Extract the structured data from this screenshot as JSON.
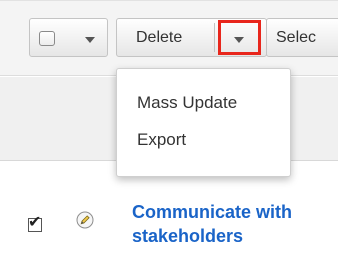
{
  "toolbar": {
    "select_all": {
      "icon": "checkbox-icon",
      "dropdown_icon": "caret-down-icon"
    },
    "delete_label": "Delete",
    "actions_dropdown_icon": "caret-down-icon",
    "highlight_color": "#e8261c",
    "truncated_label": "Selec"
  },
  "actions_menu": {
    "items": [
      {
        "label": "Mass Update"
      },
      {
        "label": "Export"
      }
    ]
  },
  "list": {
    "rows": [
      {
        "checked": true,
        "edit_icon": "pencil-icon",
        "title": "Communicate with\nstakeholders",
        "title_color": "#1a64c8"
      }
    ]
  }
}
